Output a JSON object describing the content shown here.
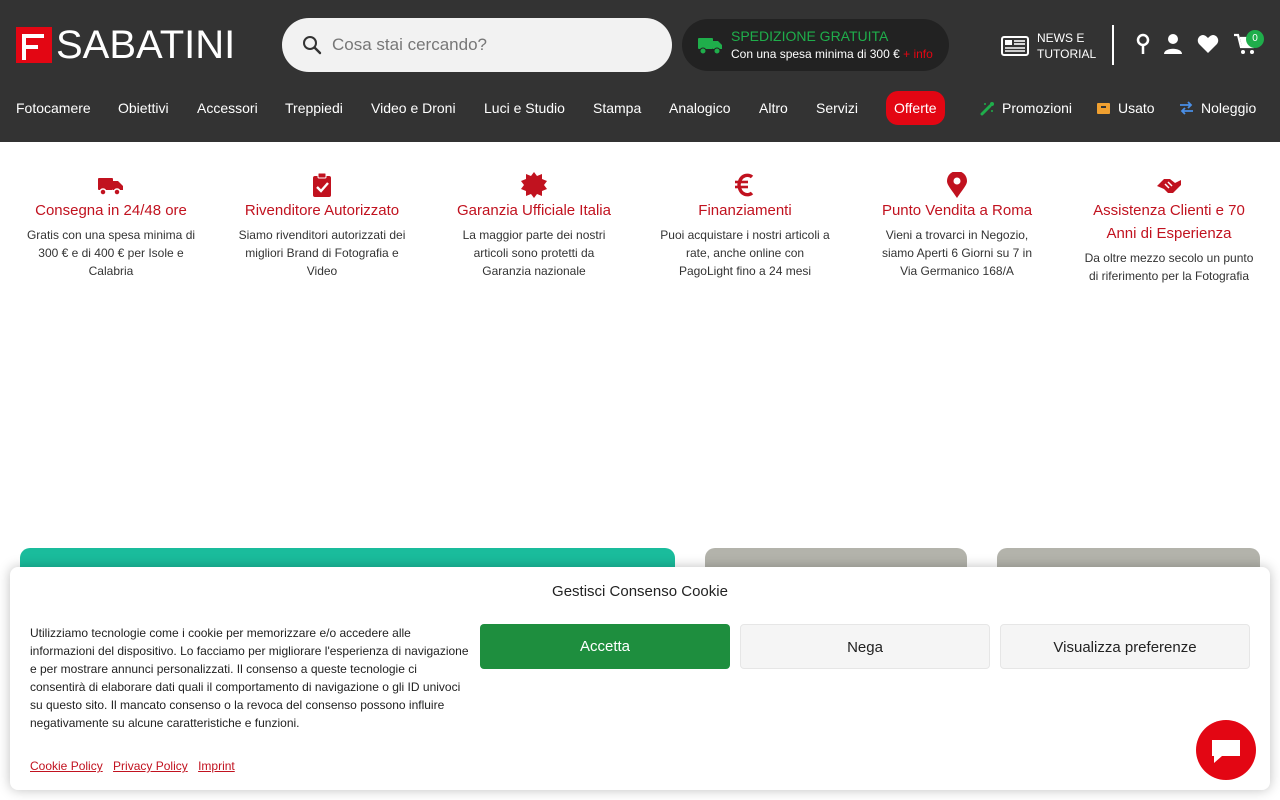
{
  "header": {
    "logo_text": "SABATINI",
    "search_placeholder": "Cosa stai cercando?",
    "shipping_title": "SPEDIZIONE GRATUITA",
    "shipping_sub": "Con una spesa minima di 300 €",
    "shipping_more": "+ info",
    "news_line1": "NEWS E",
    "news_line2": "TUTORIAL",
    "cart_count": "0"
  },
  "nav": {
    "items": [
      "Fotocamere",
      "Obiettivi",
      "Accessori",
      "Treppiedi",
      "Video e Droni",
      "Luci e Studio",
      "Stampa",
      "Analogico",
      "Altro",
      "Servizi",
      "Offerte"
    ],
    "right": [
      "Promozioni",
      "Usato",
      "Noleggio"
    ]
  },
  "features": [
    {
      "icon": "truck-icon",
      "title": "Consegna in 24/48 ore",
      "desc": "Gratis con una spesa minima di 300 € e di 400 € per Isole e Calabria"
    },
    {
      "icon": "clipboard-check-icon",
      "title": "Rivenditore Autorizzato",
      "desc": "Siamo rivenditori autorizzati dei migliori Brand di Fotografia e Video"
    },
    {
      "icon": "badge-check-icon",
      "title": "Garanzia Ufficiale Italia",
      "desc": "La maggior parte dei nostri articoli sono protetti da Garanzia nazionale"
    },
    {
      "icon": "euro-icon",
      "title": "Finanziamenti",
      "desc": "Puoi acquistare i nostri articoli a rate, anche online con PagoLight fino a 24 mesi"
    },
    {
      "icon": "map-pin-icon",
      "title": "Punto Vendita a Roma",
      "desc": "Vieni a trovarci in Negozio, siamo Aperti 6 Giorni su 7 in Via Germanico 168/A"
    },
    {
      "icon": "handshake-icon",
      "title": "Assistenza Clienti e 70 Anni di Esperienza",
      "desc": "Da oltre mezzo secolo un punto di riferimento per la Fotografia"
    }
  ],
  "cookie": {
    "title": "Gestisci Consenso Cookie",
    "text": "Utilizziamo tecnologie come i cookie per memorizzare e/o accedere alle informazioni del dispositivo. Lo facciamo per migliorare l'esperienza di navigazione e per mostrare annunci personalizzati. Il consenso a queste tecnologie ci consentirà di elaborare dati quali il comportamento di navigazione o gli ID univoci su questo sito. Il mancato consenso o la revoca del consenso possono influire negativamente su alcune caratteristiche e funzioni.",
    "accept": "Accetta",
    "deny": "Nega",
    "prefs": "Visualizza preferenze",
    "links": [
      "Cookie Policy",
      "Privacy Policy",
      "Imprint"
    ]
  },
  "colors": {
    "brand_red": "#e30613",
    "header_bg": "#333333",
    "accept_green": "#1e8e3e",
    "card_teal": "#1abc9c",
    "card_grey": "#b3b3ab"
  }
}
